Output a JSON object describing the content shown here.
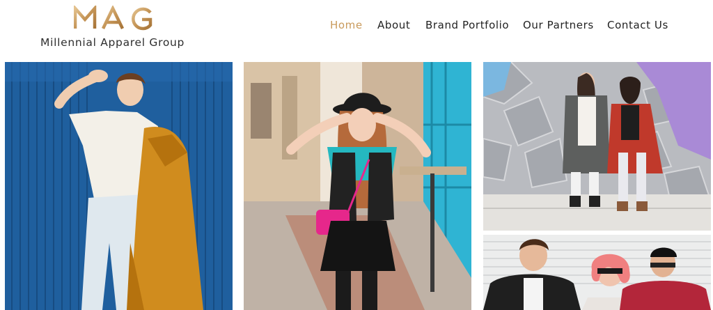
{
  "brand": {
    "logo_letters": "MAG",
    "tagline": "Millennial Apparel Group"
  },
  "nav": {
    "items": [
      {
        "label": "Home",
        "active": true
      },
      {
        "label": "About",
        "active": false
      },
      {
        "label": "Brand Portfolio",
        "active": false
      },
      {
        "label": "Our Partners",
        "active": false
      },
      {
        "label": "Contact Us",
        "active": false
      }
    ]
  },
  "gallery": [
    {
      "subject": "man in white outfit with mustard coat against blue wall"
    },
    {
      "subject": "woman in black hat with pink bag on street"
    },
    {
      "subject": "two women posing on stone steps"
    },
    {
      "subject": "three friends laughing by a white shutter"
    }
  ],
  "colors": {
    "accent": "#c99a5b",
    "nav_text": "#222222",
    "logo_gold": "#c9a26a"
  }
}
